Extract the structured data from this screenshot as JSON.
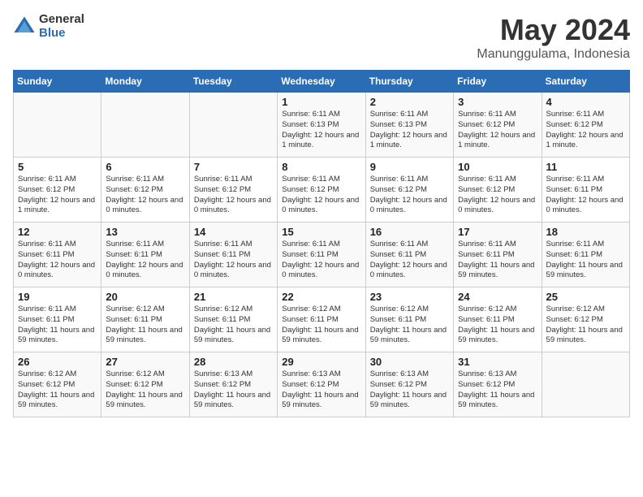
{
  "logo": {
    "general": "General",
    "blue": "Blue"
  },
  "title": "May 2024",
  "subtitle": "Manunggulama, Indonesia",
  "days": [
    "Sunday",
    "Monday",
    "Tuesday",
    "Wednesday",
    "Thursday",
    "Friday",
    "Saturday"
  ],
  "weeks": [
    [
      {
        "day": "",
        "info": ""
      },
      {
        "day": "",
        "info": ""
      },
      {
        "day": "",
        "info": ""
      },
      {
        "day": "1",
        "info": "Sunrise: 6:11 AM\nSunset: 6:13 PM\nDaylight: 12 hours and 1 minute."
      },
      {
        "day": "2",
        "info": "Sunrise: 6:11 AM\nSunset: 6:13 PM\nDaylight: 12 hours and 1 minute."
      },
      {
        "day": "3",
        "info": "Sunrise: 6:11 AM\nSunset: 6:12 PM\nDaylight: 12 hours and 1 minute."
      },
      {
        "day": "4",
        "info": "Sunrise: 6:11 AM\nSunset: 6:12 PM\nDaylight: 12 hours and 1 minute."
      }
    ],
    [
      {
        "day": "5",
        "info": "Sunrise: 6:11 AM\nSunset: 6:12 PM\nDaylight: 12 hours and 1 minute."
      },
      {
        "day": "6",
        "info": "Sunrise: 6:11 AM\nSunset: 6:12 PM\nDaylight: 12 hours and 0 minutes."
      },
      {
        "day": "7",
        "info": "Sunrise: 6:11 AM\nSunset: 6:12 PM\nDaylight: 12 hours and 0 minutes."
      },
      {
        "day": "8",
        "info": "Sunrise: 6:11 AM\nSunset: 6:12 PM\nDaylight: 12 hours and 0 minutes."
      },
      {
        "day": "9",
        "info": "Sunrise: 6:11 AM\nSunset: 6:12 PM\nDaylight: 12 hours and 0 minutes."
      },
      {
        "day": "10",
        "info": "Sunrise: 6:11 AM\nSunset: 6:12 PM\nDaylight: 12 hours and 0 minutes."
      },
      {
        "day": "11",
        "info": "Sunrise: 6:11 AM\nSunset: 6:11 PM\nDaylight: 12 hours and 0 minutes."
      }
    ],
    [
      {
        "day": "12",
        "info": "Sunrise: 6:11 AM\nSunset: 6:11 PM\nDaylight: 12 hours and 0 minutes."
      },
      {
        "day": "13",
        "info": "Sunrise: 6:11 AM\nSunset: 6:11 PM\nDaylight: 12 hours and 0 minutes."
      },
      {
        "day": "14",
        "info": "Sunrise: 6:11 AM\nSunset: 6:11 PM\nDaylight: 12 hours and 0 minutes."
      },
      {
        "day": "15",
        "info": "Sunrise: 6:11 AM\nSunset: 6:11 PM\nDaylight: 12 hours and 0 minutes."
      },
      {
        "day": "16",
        "info": "Sunrise: 6:11 AM\nSunset: 6:11 PM\nDaylight: 12 hours and 0 minutes."
      },
      {
        "day": "17",
        "info": "Sunrise: 6:11 AM\nSunset: 6:11 PM\nDaylight: 11 hours and 59 minutes."
      },
      {
        "day": "18",
        "info": "Sunrise: 6:11 AM\nSunset: 6:11 PM\nDaylight: 11 hours and 59 minutes."
      }
    ],
    [
      {
        "day": "19",
        "info": "Sunrise: 6:11 AM\nSunset: 6:11 PM\nDaylight: 11 hours and 59 minutes."
      },
      {
        "day": "20",
        "info": "Sunrise: 6:12 AM\nSunset: 6:11 PM\nDaylight: 11 hours and 59 minutes."
      },
      {
        "day": "21",
        "info": "Sunrise: 6:12 AM\nSunset: 6:11 PM\nDaylight: 11 hours and 59 minutes."
      },
      {
        "day": "22",
        "info": "Sunrise: 6:12 AM\nSunset: 6:11 PM\nDaylight: 11 hours and 59 minutes."
      },
      {
        "day": "23",
        "info": "Sunrise: 6:12 AM\nSunset: 6:11 PM\nDaylight: 11 hours and 59 minutes."
      },
      {
        "day": "24",
        "info": "Sunrise: 6:12 AM\nSunset: 6:11 PM\nDaylight: 11 hours and 59 minutes."
      },
      {
        "day": "25",
        "info": "Sunrise: 6:12 AM\nSunset: 6:12 PM\nDaylight: 11 hours and 59 minutes."
      }
    ],
    [
      {
        "day": "26",
        "info": "Sunrise: 6:12 AM\nSunset: 6:12 PM\nDaylight: 11 hours and 59 minutes."
      },
      {
        "day": "27",
        "info": "Sunrise: 6:12 AM\nSunset: 6:12 PM\nDaylight: 11 hours and 59 minutes."
      },
      {
        "day": "28",
        "info": "Sunrise: 6:13 AM\nSunset: 6:12 PM\nDaylight: 11 hours and 59 minutes."
      },
      {
        "day": "29",
        "info": "Sunrise: 6:13 AM\nSunset: 6:12 PM\nDaylight: 11 hours and 59 minutes."
      },
      {
        "day": "30",
        "info": "Sunrise: 6:13 AM\nSunset: 6:12 PM\nDaylight: 11 hours and 59 minutes."
      },
      {
        "day": "31",
        "info": "Sunrise: 6:13 AM\nSunset: 6:12 PM\nDaylight: 11 hours and 59 minutes."
      },
      {
        "day": "",
        "info": ""
      }
    ]
  ]
}
